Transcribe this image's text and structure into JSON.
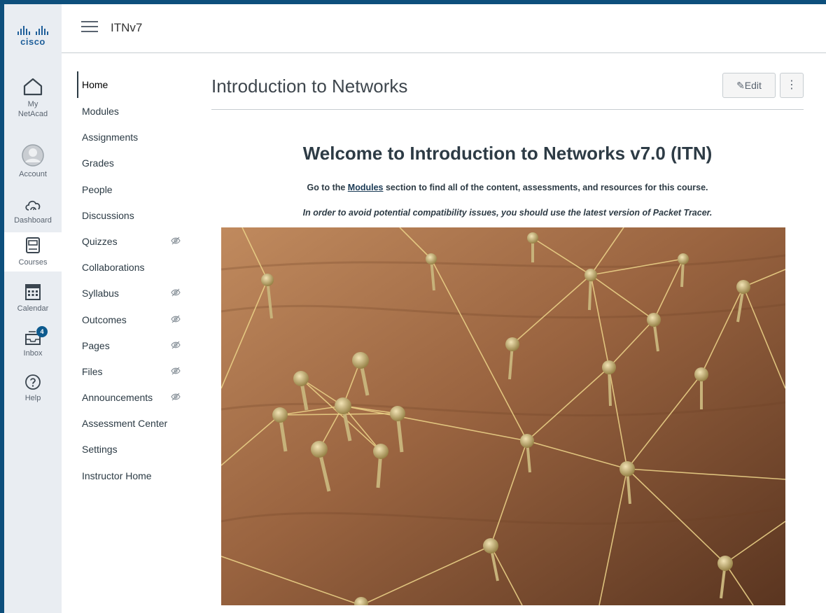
{
  "brand": {
    "logo_text": "cisco"
  },
  "global_nav": {
    "items": [
      {
        "label_line1": "My",
        "label_line2": "NetAcad",
        "icon": "home-icon"
      },
      {
        "label": "Account",
        "icon": "account-icon"
      },
      {
        "label": "Dashboard",
        "icon": "dashboard-icon"
      },
      {
        "label": "Courses",
        "icon": "courses-icon"
      },
      {
        "label": "Calendar",
        "icon": "calendar-icon"
      },
      {
        "label": "Inbox",
        "icon": "inbox-icon",
        "badge": "4"
      },
      {
        "label": "Help",
        "icon": "help-icon"
      }
    ]
  },
  "header": {
    "breadcrumb": "ITNv7"
  },
  "course_nav": {
    "items": [
      {
        "label": "Home",
        "hidden": false
      },
      {
        "label": "Modules",
        "hidden": false
      },
      {
        "label": "Assignments",
        "hidden": false
      },
      {
        "label": "Grades",
        "hidden": false
      },
      {
        "label": "People",
        "hidden": false
      },
      {
        "label": "Discussions",
        "hidden": false
      },
      {
        "label": "Quizzes",
        "hidden": true
      },
      {
        "label": "Collaborations",
        "hidden": false
      },
      {
        "label": "Syllabus",
        "hidden": true
      },
      {
        "label": "Outcomes",
        "hidden": true
      },
      {
        "label": "Pages",
        "hidden": true
      },
      {
        "label": "Files",
        "hidden": true
      },
      {
        "label": "Announcements",
        "hidden": true
      },
      {
        "label": "Assessment Center",
        "hidden": false
      },
      {
        "label": "Settings",
        "hidden": false
      },
      {
        "label": "Instructor Home",
        "hidden": false
      }
    ]
  },
  "page": {
    "title": "Introduction to Networks",
    "edit_label": "Edit",
    "more_label": "⋮",
    "welcome_heading": "Welcome to Introduction to Networks v7.0 (ITN)",
    "intro_prefix": "Go to the ",
    "intro_link": "Modules",
    "intro_suffix": " section to find all of the content, assessments, and resources for this course.",
    "notice": "In order to avoid potential compatibility issues, you should use the latest version of Packet Tracer."
  },
  "colors": {
    "brand_blue": "#0d4f7c",
    "nav_bg": "#e9edf2",
    "text_dark": "#2d3b45",
    "border": "#c7cdd1"
  }
}
